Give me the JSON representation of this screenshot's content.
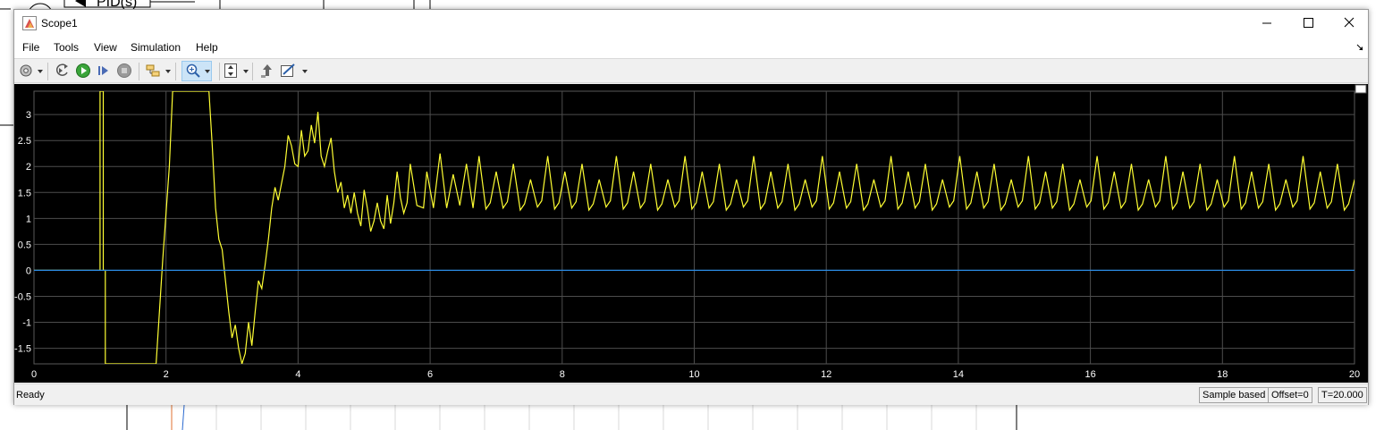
{
  "background": {
    "block_label": "PID(s)"
  },
  "window": {
    "title": "Scope1",
    "icon": "simulink-scope-icon",
    "controls": [
      "minimize-icon",
      "maximize-icon",
      "close-icon"
    ]
  },
  "menu": {
    "items": [
      "File",
      "Tools",
      "View",
      "Simulation",
      "Help"
    ]
  },
  "toolbar": {
    "icons": [
      "settings-icon",
      "step-back-icon",
      "run-icon",
      "step-forward-icon",
      "stop-icon",
      "signal-selection-icon",
      "zoom-in-icon",
      "scale-axes-icon",
      "highlight-simulink-block-icon",
      "measurement-icon"
    ],
    "active": "zoom-in-icon"
  },
  "status": {
    "text": "Ready",
    "mode": "Sample based",
    "offset": "Offset=0",
    "time": "T=20.000"
  },
  "colors": {
    "plot_background": "#000000",
    "grid": "#4d4d4d",
    "tick_label": "#ffffff",
    "series_1": "#ffff33",
    "series_2": "#2b8ae2"
  },
  "chart_data": {
    "type": "line",
    "xlim": [
      0,
      20
    ],
    "ylim": [
      -1.8,
      3.45
    ],
    "x_ticks": [
      "0",
      "2",
      "4",
      "6",
      "8",
      "10",
      "12",
      "14",
      "16",
      "18",
      "20"
    ],
    "y_ticks": [
      "3",
      "2.5",
      "2",
      "1.5",
      "1",
      "0.5",
      "0",
      "-0.5",
      "-1",
      "-1.5"
    ],
    "y_tick_values": [
      3,
      2.5,
      2,
      1.5,
      1,
      0.5,
      0,
      -0.5,
      -1,
      -1.5
    ],
    "grid": true,
    "series": [
      {
        "color": "#ffff33",
        "points": [
          [
            0,
            0
          ],
          [
            1.0,
            0
          ],
          [
            1.0,
            3.45
          ],
          [
            1.05,
            3.45
          ],
          [
            1.05,
            0
          ],
          [
            1.08,
            0
          ],
          [
            1.08,
            -1.8
          ],
          [
            1.85,
            -1.8
          ],
          [
            1.95,
            0.2
          ],
          [
            2.05,
            2.0
          ],
          [
            2.1,
            3.45
          ],
          [
            2.65,
            3.45
          ],
          [
            2.7,
            2.4
          ],
          [
            2.75,
            1.2
          ],
          [
            2.8,
            0.6
          ],
          [
            2.85,
            0.4
          ],
          [
            2.9,
            -0.2
          ],
          [
            2.95,
            -0.8
          ],
          [
            3.0,
            -1.3
          ],
          [
            3.05,
            -1.05
          ],
          [
            3.1,
            -1.5
          ],
          [
            3.15,
            -1.8
          ],
          [
            3.2,
            -1.6
          ],
          [
            3.25,
            -1.0
          ],
          [
            3.3,
            -1.45
          ],
          [
            3.35,
            -0.8
          ],
          [
            3.4,
            -0.2
          ],
          [
            3.45,
            -0.35
          ],
          [
            3.5,
            0.1
          ],
          [
            3.55,
            0.6
          ],
          [
            3.6,
            1.2
          ],
          [
            3.65,
            1.6
          ],
          [
            3.7,
            1.35
          ],
          [
            3.8,
            2.0
          ],
          [
            3.85,
            2.6
          ],
          [
            3.9,
            2.4
          ],
          [
            3.95,
            2.05
          ],
          [
            4.0,
            2.0
          ],
          [
            4.05,
            2.7
          ],
          [
            4.1,
            2.2
          ],
          [
            4.15,
            2.3
          ],
          [
            4.2,
            2.8
          ],
          [
            4.25,
            2.45
          ],
          [
            4.3,
            3.05
          ],
          [
            4.35,
            2.2
          ],
          [
            4.4,
            2.0
          ],
          [
            4.45,
            2.3
          ],
          [
            4.5,
            2.55
          ],
          [
            4.55,
            1.9
          ],
          [
            4.6,
            1.5
          ],
          [
            4.65,
            1.7
          ],
          [
            4.7,
            1.2
          ],
          [
            4.75,
            1.45
          ],
          [
            4.8,
            1.1
          ],
          [
            4.85,
            1.5
          ],
          [
            4.9,
            1.1
          ],
          [
            4.95,
            0.85
          ],
          [
            5.0,
            1.55
          ],
          [
            5.05,
            1.2
          ],
          [
            5.1,
            0.75
          ],
          [
            5.15,
            0.95
          ],
          [
            5.2,
            1.3
          ],
          [
            5.25,
            0.95
          ],
          [
            5.3,
            0.8
          ],
          [
            5.35,
            1.45
          ],
          [
            5.4,
            0.9
          ],
          [
            5.45,
            1.3
          ],
          [
            5.5,
            1.9
          ],
          [
            5.55,
            1.4
          ],
          [
            5.6,
            1.1
          ],
          [
            5.65,
            1.3
          ],
          [
            5.7,
            2.05
          ],
          [
            5.8,
            1.25
          ],
          [
            5.9,
            1.2
          ],
          [
            5.95,
            1.9
          ],
          [
            6.05,
            1.2
          ],
          [
            6.15,
            2.25
          ],
          [
            6.25,
            1.2
          ],
          [
            6.35,
            1.85
          ],
          [
            6.45,
            1.25
          ],
          [
            6.55,
            2.05
          ],
          [
            6.65,
            1.2
          ]
        ]
      },
      {
        "color": "#2b8ae2",
        "points": [
          [
            0,
            0
          ],
          [
            20,
            0
          ]
        ]
      }
    ],
    "steady_oscillation": {
      "series_index": 0,
      "x_start": 6.65,
      "x_end": 20,
      "period": 0.26,
      "peak_values": [
        2.2,
        1.9,
        2.05,
        1.75
      ],
      "trough_values": [
        1.18,
        1.2,
        1.16,
        1.22
      ]
    }
  }
}
